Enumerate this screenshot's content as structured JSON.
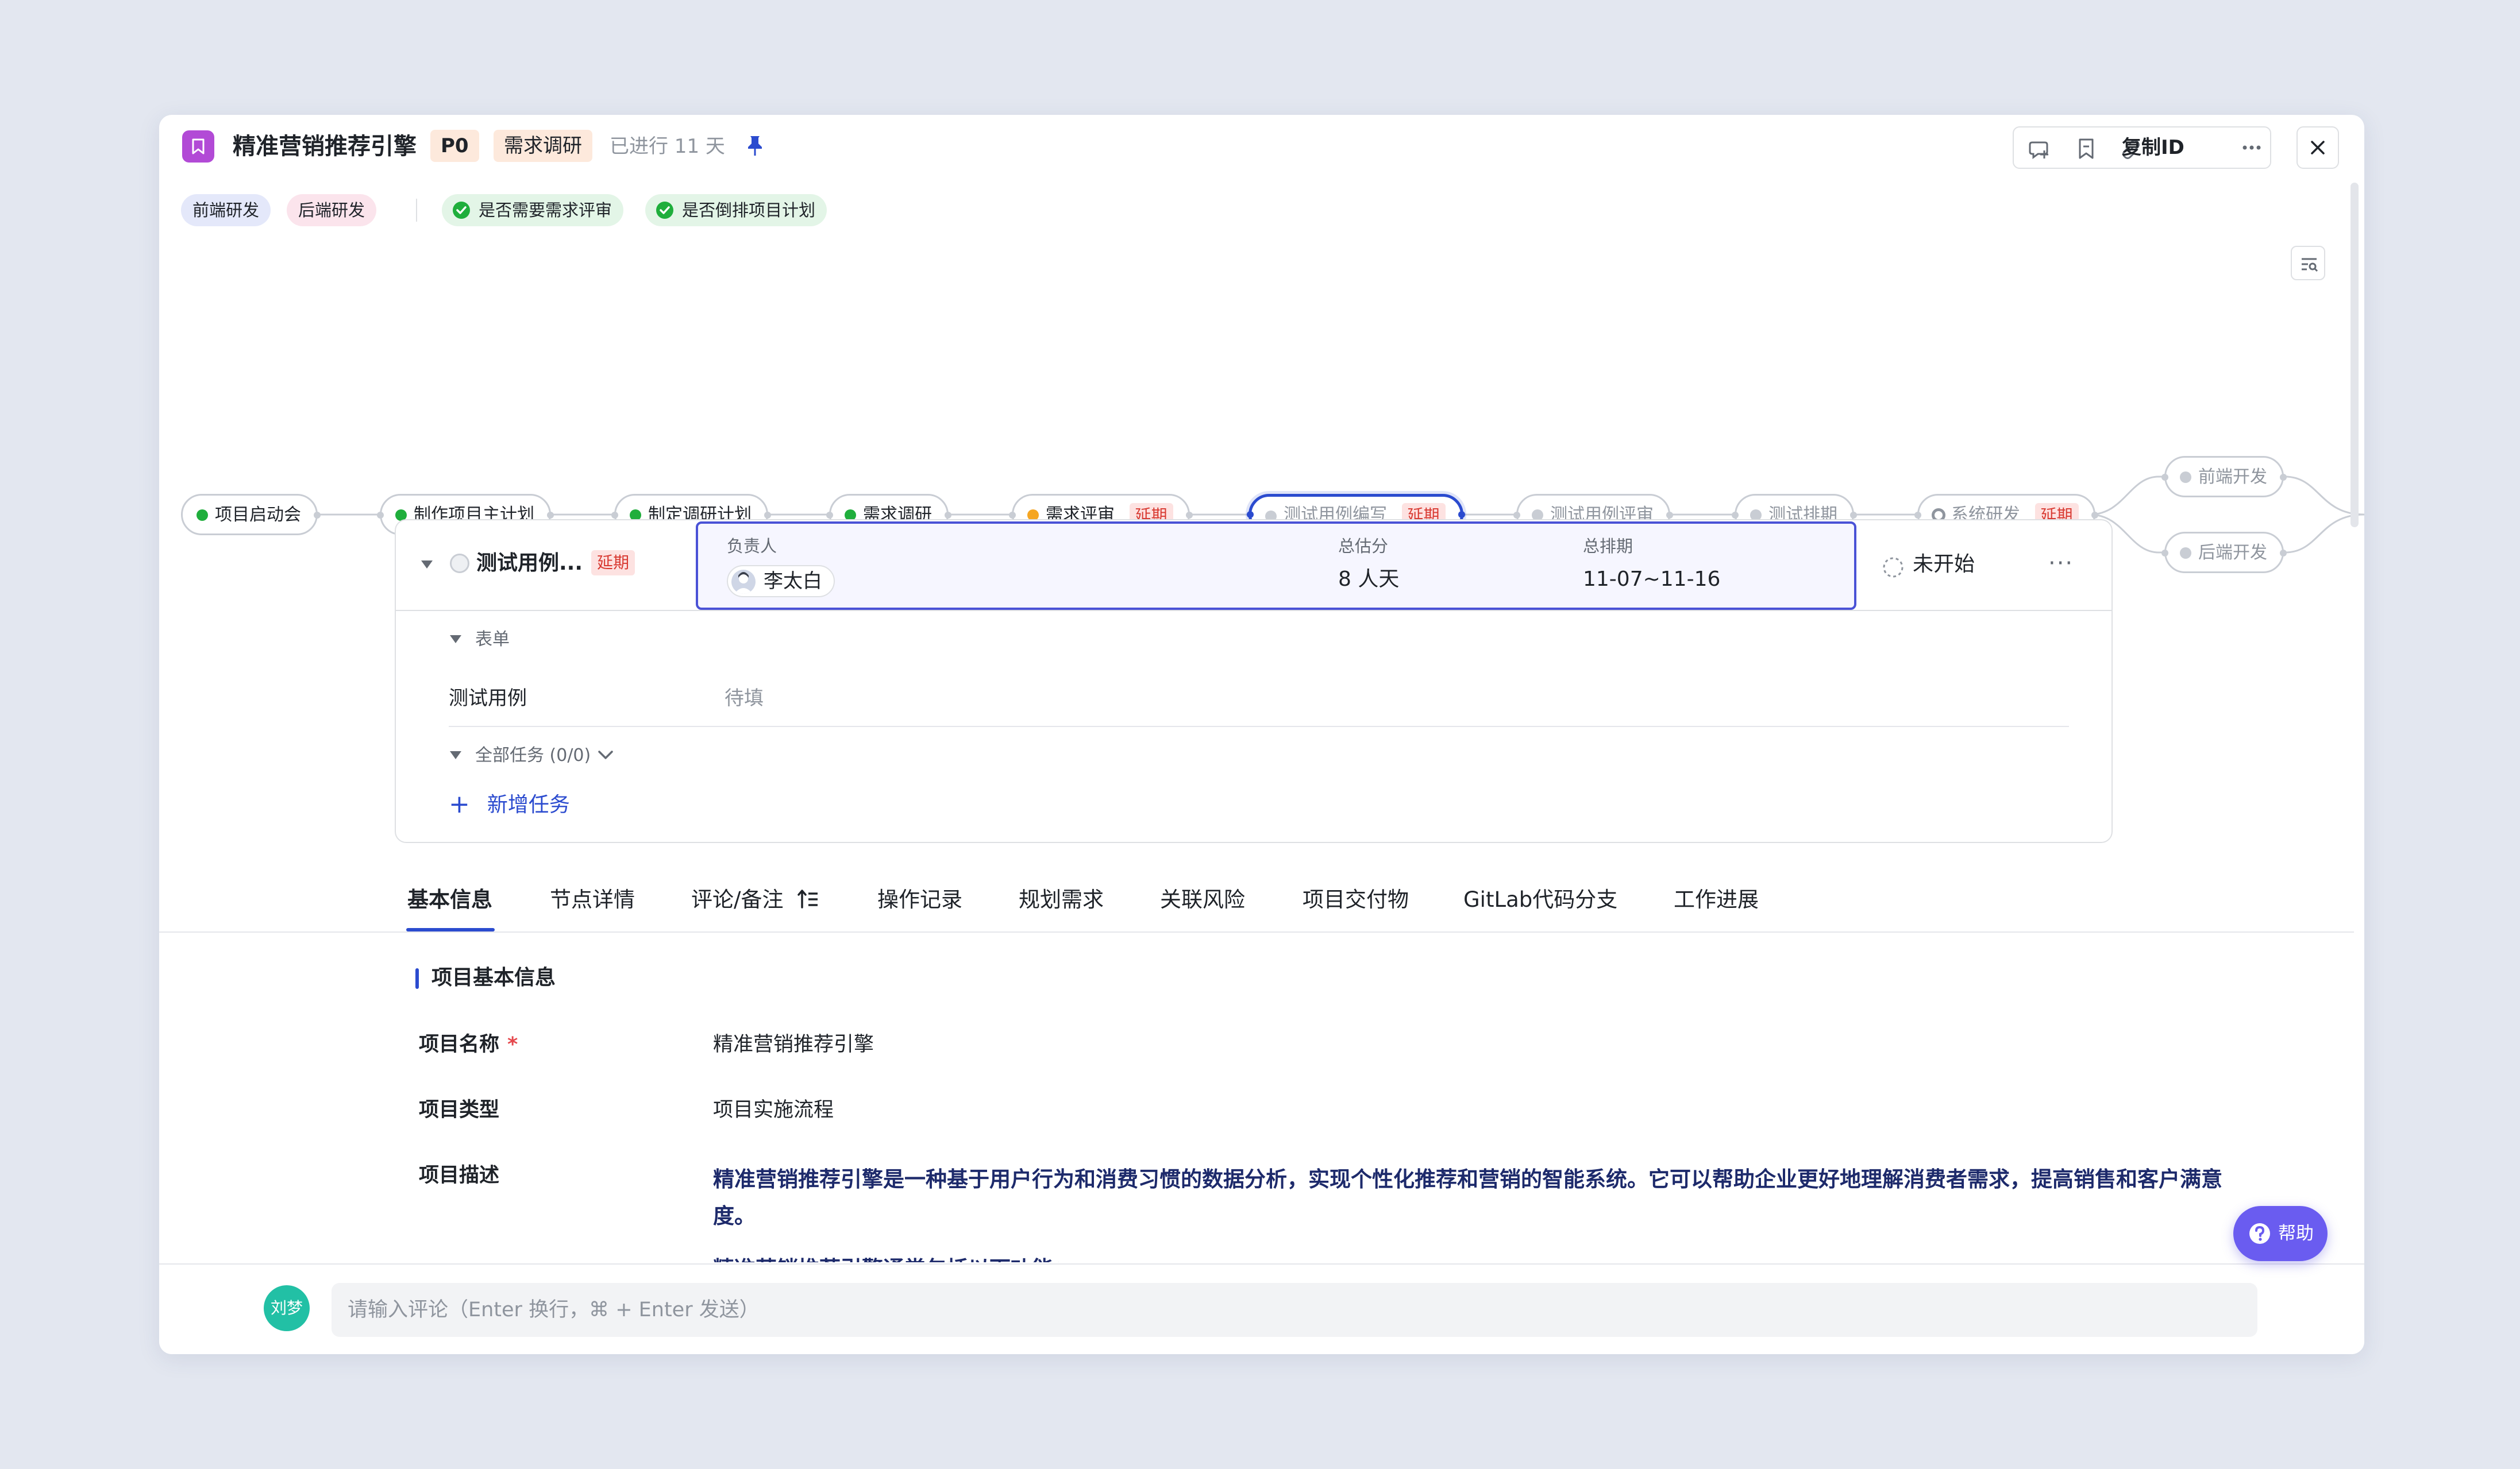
{
  "header": {
    "title": "精准营销推荐引擎",
    "priority": "P0",
    "stage": "需求调研",
    "elapsed": "已进行 11 天",
    "copy_id": "复制ID"
  },
  "chips": {
    "frontend": "前端研发",
    "backend": "后端研发",
    "check1": "是否需要需求评审",
    "check2": "是否倒排项目计划"
  },
  "flow": {
    "n1": "项目启动会",
    "n2": "制作项目主计划",
    "n3": "制定调研计划",
    "n4": "需求调研",
    "n5": "需求评审",
    "n6": "测试用例编写",
    "n7": "测试用例评审",
    "n8": "测试排期",
    "n9": "系统研发",
    "n10": "前端开发",
    "n11": "后端开发",
    "delay": "延期"
  },
  "panel": {
    "name": "测试用例...",
    "delay": "延期",
    "owner_label": "负责人",
    "owner": "李太白",
    "estimate_label": "总估分",
    "estimate": "8 人天",
    "schedule_label": "总排期",
    "schedule": "11-07~11-16",
    "status": "未开始",
    "more": "···",
    "form_label": "表单",
    "form_field": "测试用例",
    "form_value": "待填",
    "tasks_label": "全部任务 (0/0)",
    "add_task": "新增任务"
  },
  "tabs": [
    "基本信息",
    "节点详情",
    "评论/备注",
    "操作记录",
    "规划需求",
    "关联风险",
    "项目交付物",
    "GitLab代码分支",
    "工作进展"
  ],
  "basic": {
    "section": "项目基本信息",
    "name_label": "项目名称",
    "name": "精准营销推荐引擎",
    "type_label": "项目类型",
    "type": "项目实施流程",
    "desc_label": "项目描述",
    "desc": "精准营销推荐引擎是一种基于用户行为和消费习惯的数据分析，实现个性化推荐和营销的智能系统。它可以帮助企业更好地理解消费者需求，提高销售和客户满意度。",
    "desc_more": "精准营销推荐引擎通常包括以下功能："
  },
  "help": "帮助",
  "comment": {
    "avatar": "刘梦",
    "placeholder": "请输入评论（Enter 换行，⌘ + Enter 发送）"
  },
  "colors": {
    "accent": "#2b4bcf",
    "done": "#1fae3c",
    "in_progress": "#f5a623",
    "delay_bg": "#fde2e1",
    "delay_text": "#d83931"
  }
}
